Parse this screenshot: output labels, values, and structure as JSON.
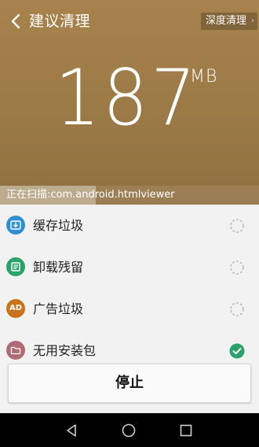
{
  "header": {
    "title": "建议清理",
    "deep_clean_label": "深度清理",
    "size_value": "187",
    "size_unit": "MB",
    "scan_text": "正在扫描:com.android.htmlviewer",
    "scan_progress": 0.37,
    "background_color": "#a0804a"
  },
  "list": {
    "items": [
      {
        "label": "缓存垃圾",
        "icon": "download-box-icon",
        "icon_color": "#2f8fd0",
        "status": "scanning"
      },
      {
        "label": "卸载残留",
        "icon": "document-icon",
        "icon_color": "#2aa36a",
        "status": "scanning"
      },
      {
        "label": "广告垃圾",
        "icon": "ad-icon",
        "icon_text": "AD",
        "icon_color": "#c9741c",
        "status": "scanning"
      },
      {
        "label": "无用安装包",
        "icon": "folder-icon",
        "icon_color": "#b06a73",
        "status": "done"
      }
    ]
  },
  "stop_button": {
    "label": "停止"
  },
  "colors": {
    "done_check": "#2aa36a",
    "spinner": "#bdbdbd"
  }
}
